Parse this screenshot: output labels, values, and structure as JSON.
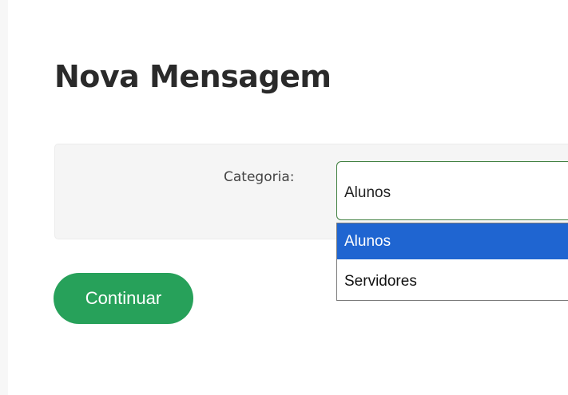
{
  "page": {
    "title": "Nova Mensagem"
  },
  "form": {
    "category_label": "Categoria:",
    "category_selected": "Alunos",
    "category_options": [
      "Alunos",
      "Servidores"
    ],
    "highlighted_option": "Alunos"
  },
  "actions": {
    "continue_label": "Continuar"
  },
  "colors": {
    "accent_green": "#27a15a",
    "select_border": "#3f7f3f",
    "selection_blue": "#1f65d1",
    "panel_bg": "#f5f5f5"
  }
}
